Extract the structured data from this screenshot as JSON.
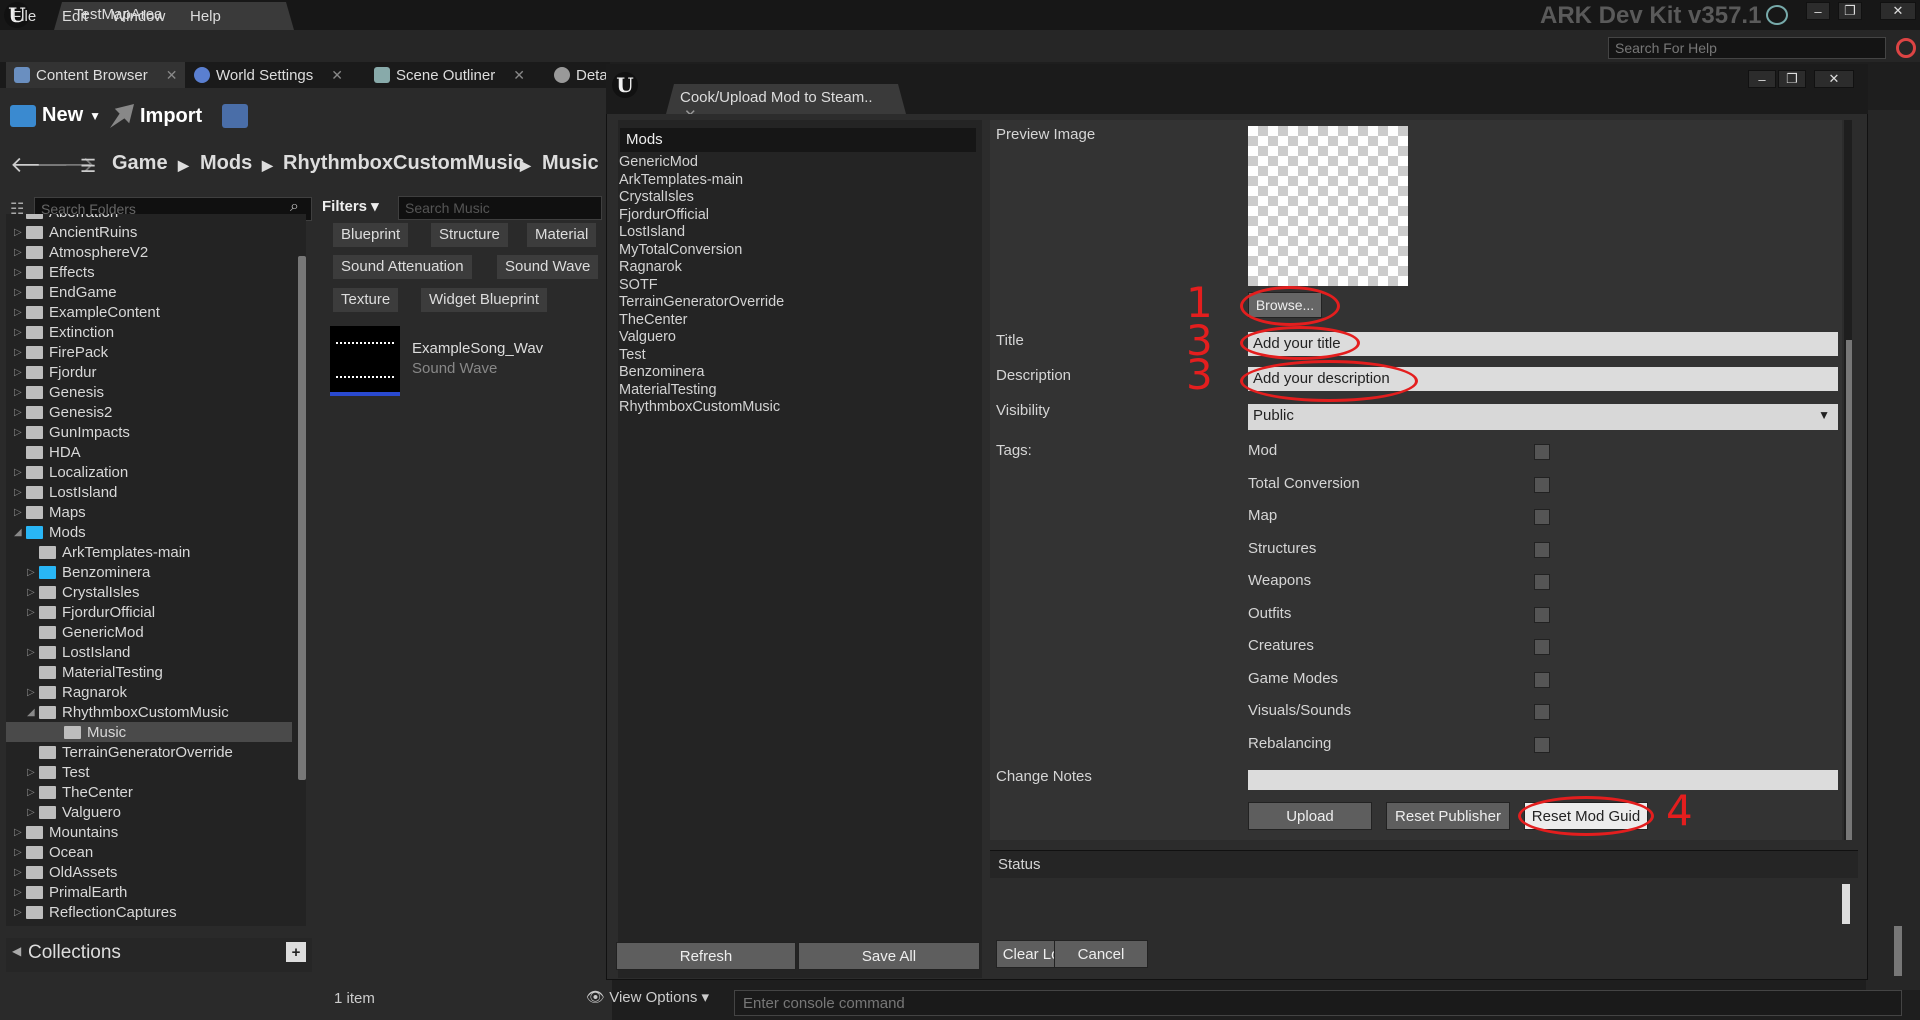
{
  "titlebar": {
    "tab": "TestMapArea",
    "devkit": "ARK Dev Kit v357.1",
    "min": "–",
    "max": "❐",
    "close": "✕"
  },
  "menu": [
    "File",
    "Edit",
    "Window",
    "Help"
  ],
  "help_search": "Search For Help",
  "panel_tabs": [
    "Content Browser",
    "World Settings",
    "Scene Outliner",
    "Deta"
  ],
  "toolbar": {
    "new": "New",
    "import": "Import"
  },
  "breadcrumb": [
    "Game",
    "Mods",
    "RhythmboxCustomMusic",
    "Music"
  ],
  "folders_search": "Search Folders",
  "filters": "Filters",
  "music_search": "Search Music",
  "filter_chips": [
    "Blueprint",
    "Structure",
    "Material",
    "Sound Attenuation",
    "Sound Wave",
    "Texture",
    "Widget Blueprint"
  ],
  "asset": {
    "name": "ExampleSong_Wav",
    "type": "Sound Wave"
  },
  "tree": [
    "Aberration",
    "AncientRuins",
    "AtmosphereV2",
    "Effects",
    "EndGame",
    "ExampleContent",
    "Extinction",
    "FirePack",
    "Fjordur",
    "Genesis",
    "Genesis2",
    "GunImpacts",
    "HDA",
    "Localization",
    "LostIsland",
    "Maps",
    "Mods",
    "ArkTemplates-main",
    "Benzominera",
    "CrystalIsles",
    "FjordurOfficial",
    "GenericMod",
    "LostIsland",
    "MaterialTesting",
    "Ragnarok",
    "RhythmboxCustomMusic",
    "Music",
    "TerrainGeneratorOverride",
    "Test",
    "TheCenter",
    "Valguero",
    "Mountains",
    "Ocean",
    "OldAssets",
    "PrimalEarth",
    "ReflectionCaptures"
  ],
  "collections": "Collections",
  "item_count": "1 item",
  "view_options": "View Options",
  "dialog": {
    "title": "Cook/Upload Mod to Steam..",
    "mods_header": "Mods",
    "mods": [
      "GenericMod",
      "ArkTemplates-main",
      "CrystalIsles",
      "FjordurOfficial",
      "LostIsland",
      "MyTotalConversion",
      "Ragnarok",
      "SOTF",
      "TerrainGeneratorOverride",
      "TheCenter",
      "Valguero",
      "Test",
      "Benzominera",
      "MaterialTesting",
      "RhythmboxCustomMusic"
    ],
    "refresh": "Refresh",
    "save_all": "Save All",
    "preview_label": "Preview Image",
    "browse": "Browse...",
    "title_label": "Title",
    "title_value": "Add your title",
    "desc_label": "Description",
    "desc_value": "Add your description",
    "visibility_label": "Visibility",
    "visibility_value": "Public",
    "tags_label": "Tags:",
    "tags": [
      "Mod",
      "Total Conversion",
      "Map",
      "Structures",
      "Weapons",
      "Outfits",
      "Creatures",
      "Game Modes",
      "Visuals/Sounds",
      "Rebalancing"
    ],
    "change_notes": "Change Notes",
    "upload": "Upload",
    "reset_publisher": "Reset Publisher",
    "reset_guid": "Reset Mod Guid",
    "status": "Status",
    "clear_logs": "Clear Logs",
    "cancel": "Cancel"
  },
  "annotations": [
    "1",
    "3",
    "3",
    "4"
  ],
  "console": "Enter console command"
}
